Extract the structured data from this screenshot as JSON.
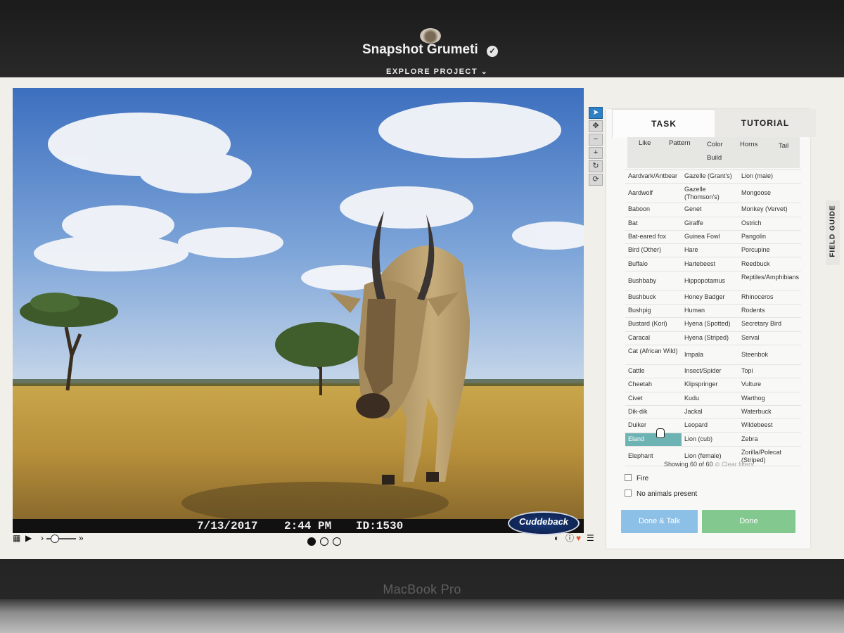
{
  "project": {
    "title": "Snapshot Grumeti",
    "explore": "EXPLORE PROJECT ⌄",
    "verified": "✓"
  },
  "laptop": {
    "label": "MacBook Pro"
  },
  "image": {
    "date": "7/13/2017",
    "time": "2:44 PM",
    "id": "ID:1530",
    "brand": "Cuddeback"
  },
  "viewer_tools": [
    "pointer-icon",
    "move-icon",
    "zoom-out-icon",
    "zoom-in-icon",
    "rotate-icon",
    "reset-icon"
  ],
  "tabs": {
    "task": "TASK",
    "tutorial": "TUTORIAL"
  },
  "filters": [
    "Like",
    "Pattern",
    "Color",
    "Horns",
    "Tail",
    "Build"
  ],
  "species": [
    [
      "Aardvark/Antbear",
      "Gazelle (Grant's)",
      "Lion (male)"
    ],
    [
      "Aardwolf",
      "Gazelle (Thomson's)",
      "Mongoose"
    ],
    [
      "Baboon",
      "Genet",
      "Monkey (Vervet)"
    ],
    [
      "Bat",
      "Giraffe",
      "Ostrich"
    ],
    [
      "Bat-eared fox",
      "Guinea Fowl",
      "Pangolin"
    ],
    [
      "Bird (Other)",
      "Hare",
      "Porcupine"
    ],
    [
      "Buffalo",
      "Hartebeest",
      "Reedbuck"
    ],
    [
      "Bushbaby",
      "Hippopotamus",
      "Reptiles/Amphibians"
    ],
    [
      "Bushbuck",
      "Honey Badger",
      "Rhinoceros"
    ],
    [
      "Bushpig",
      "Human",
      "Rodents"
    ],
    [
      "Bustard (Kori)",
      "Hyena (Spotted)",
      "Secretary Bird"
    ],
    [
      "Caracal",
      "Hyena (Striped)",
      "Serval"
    ],
    [
      "Cat (African Wild)",
      "Impala",
      "Steenbok"
    ],
    [
      "Cattle",
      "Insect/Spider",
      "Topi"
    ],
    [
      "Cheetah",
      "Klipspringer",
      "Vulture"
    ],
    [
      "Civet",
      "Kudu",
      "Warthog"
    ],
    [
      "Dik-dik",
      "Jackal",
      "Waterbuck"
    ],
    [
      "Duiker",
      "Leopard",
      "Wildebeest"
    ],
    [
      "Eland",
      "Lion (cub)",
      "Zebra"
    ],
    [
      "Elephant",
      "Lion (female)",
      "Zorilla/Polecat (Striped)"
    ]
  ],
  "selected_species": "Eland",
  "showing": "Showing 60 of 60",
  "clear_filters": "⊘ Clear filters",
  "options": {
    "fire": "Fire",
    "no_animals": "No animals present"
  },
  "buttons": {
    "done_talk": "Done & Talk",
    "done": "Done"
  },
  "field_guide": "FIELD GUIDE",
  "colors": {
    "selected": "#6db3b3",
    "done_talk": "#8cc0e6",
    "done": "#83c98f",
    "active_tool": "#2f7fc4"
  }
}
